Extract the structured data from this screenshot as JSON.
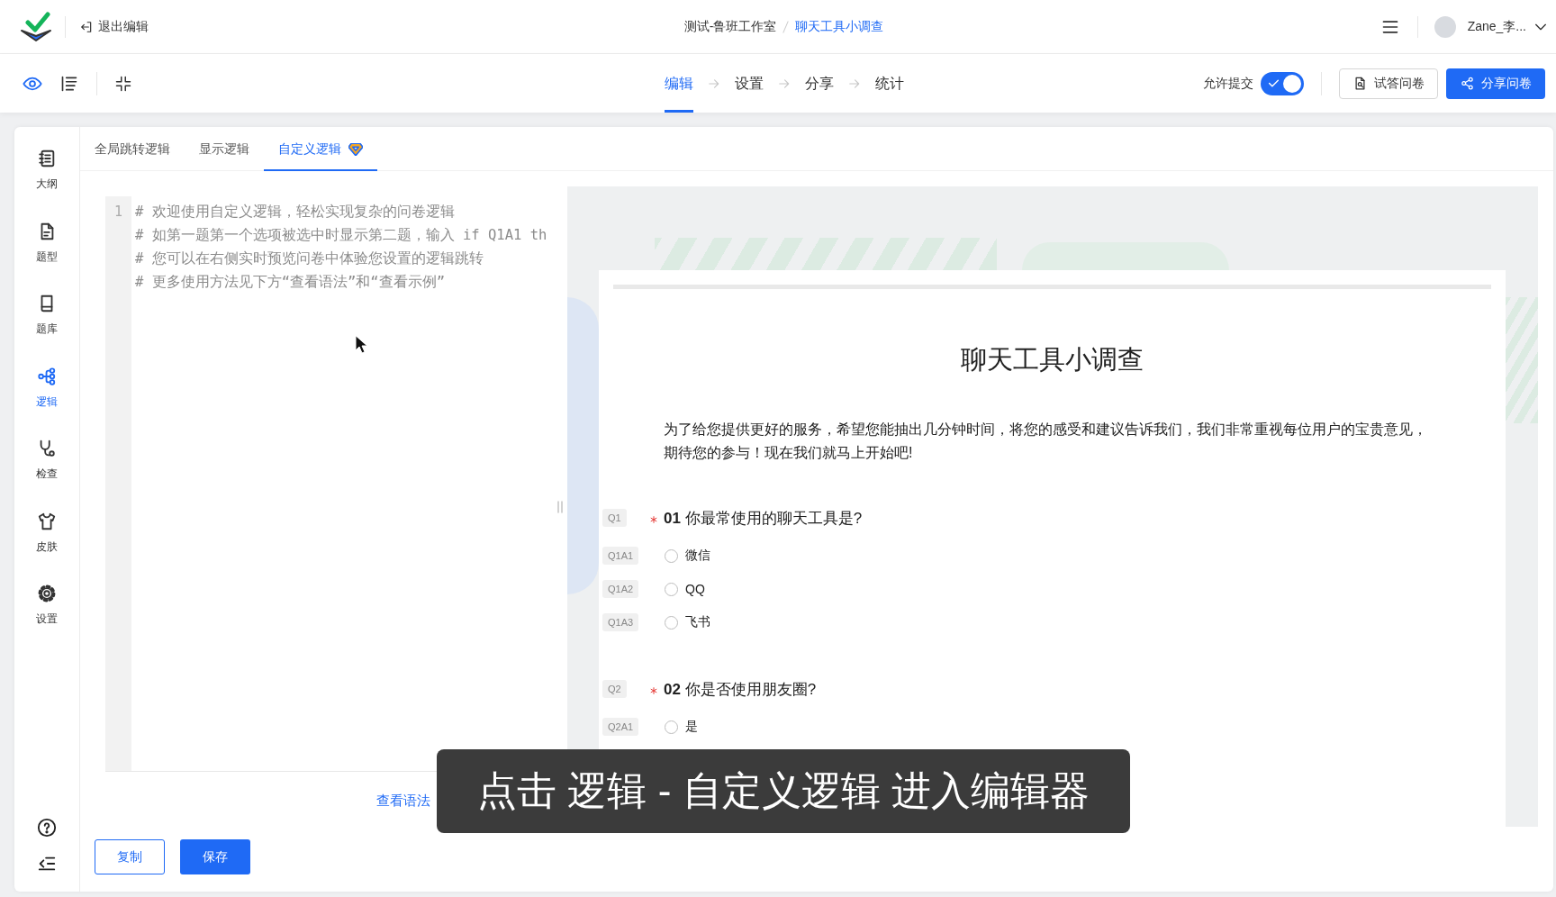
{
  "header": {
    "exit_label": "退出编辑",
    "breadcrumb": [
      {
        "label": "测试-鲁班工作室",
        "current": false
      },
      {
        "label": "聊天工具小调查",
        "current": true
      }
    ],
    "user_name": "Zane_李..."
  },
  "toolbar": {
    "steps": [
      {
        "label": "编辑",
        "selected": true
      },
      {
        "label": "设置",
        "selected": false
      },
      {
        "label": "分享",
        "selected": false
      },
      {
        "label": "统计",
        "selected": false
      }
    ],
    "allow_submit": {
      "label": "允许提交",
      "on": true
    },
    "buttons": [
      {
        "label": "试答问卷",
        "kind": "outline"
      },
      {
        "label": "分享问卷",
        "kind": "primary"
      }
    ]
  },
  "sidebar": {
    "items": [
      {
        "label": "大纲",
        "selected": false
      },
      {
        "label": "题型",
        "selected": false
      },
      {
        "label": "题库",
        "selected": false
      },
      {
        "label": "逻辑",
        "selected": true
      },
      {
        "label": "检查",
        "selected": false
      },
      {
        "label": "皮肤",
        "selected": false
      },
      {
        "label": "设置",
        "selected": false
      }
    ]
  },
  "logic_tabs": [
    {
      "label": "全局跳转逻辑",
      "selected": false,
      "premium": false
    },
    {
      "label": "显示逻辑",
      "selected": false,
      "premium": false
    },
    {
      "label": "自定义逻辑",
      "selected": true,
      "premium": true
    }
  ],
  "editor": {
    "line_numbers": [
      "1"
    ],
    "placeholder": [
      "# 欢迎使用自定义逻辑，轻松实现复杂的问卷逻辑",
      "# 如第一题第一个选项被选中时显示第二题，输入 if Q1A1 th",
      "# 您可以在右侧实时预览问卷中体验您设置的逻辑跳转",
      "# 更多使用方法见下方“查看语法”和“查看示例”"
    ],
    "links": [
      "查看语法"
    ],
    "buttons": [
      {
        "label": "复制",
        "kind": "outline"
      },
      {
        "label": "保存",
        "kind": "primary"
      }
    ]
  },
  "preview": {
    "title": "聊天工具小调查",
    "description": "为了给您提供更好的服务，希望您能抽出几分钟时间，将您的感受和建议告诉我们，我们非常重视每位用户的宝贵意见，期待您的参与！现在我们就马上开始吧!",
    "questions": [
      {
        "tag": "Q1",
        "required": true,
        "title": "**01** 你最常使用的聊天工具是?",
        "options": [
          {
            "tag": "Q1A1",
            "label": "微信",
            "selected": false
          },
          {
            "tag": "Q1A2",
            "label": "QQ",
            "selected": false
          },
          {
            "tag": "Q1A3",
            "label": "飞书",
            "selected": false
          }
        ]
      },
      {
        "tag": "Q2",
        "required": true,
        "title": "**02** 你是否使用朋友圈?",
        "options": [
          {
            "tag": "Q2A1",
            "label": "是",
            "selected": false
          }
        ]
      }
    ]
  },
  "caption": "点击 逻辑 - 自定义逻辑 进入编辑器"
}
